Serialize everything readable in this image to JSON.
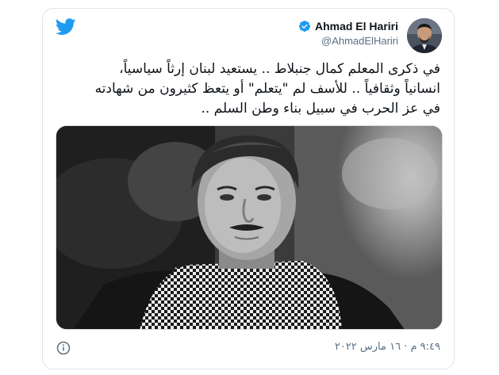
{
  "tweet": {
    "author": {
      "name": "Ahmad El Hariri",
      "handle": "@AhmadElHariri",
      "verified": true
    },
    "text_lines": [
      "في ذكرى المعلم كمال جنبلاط .. يستعيد لبنان إرثاً سياسياً،",
      "انسانياً وثقافياً .. للأسف لم \"يتعلم\" أو يتعظ كثيرون من شهادته",
      "في عز الحرب في سبيل بناء وطن السلم .."
    ],
    "timestamp": "٩:٤٩ م · ١٦ مارس ٢٠٢٢",
    "icons": {
      "brand": "twitter-bird-icon",
      "verified": "verified-badge-icon",
      "info": "info-icon"
    },
    "colors": {
      "twitter_blue": "#1d9bf0",
      "text": "#0f1419",
      "muted": "#5b7083",
      "border": "#dfe4e8"
    }
  }
}
